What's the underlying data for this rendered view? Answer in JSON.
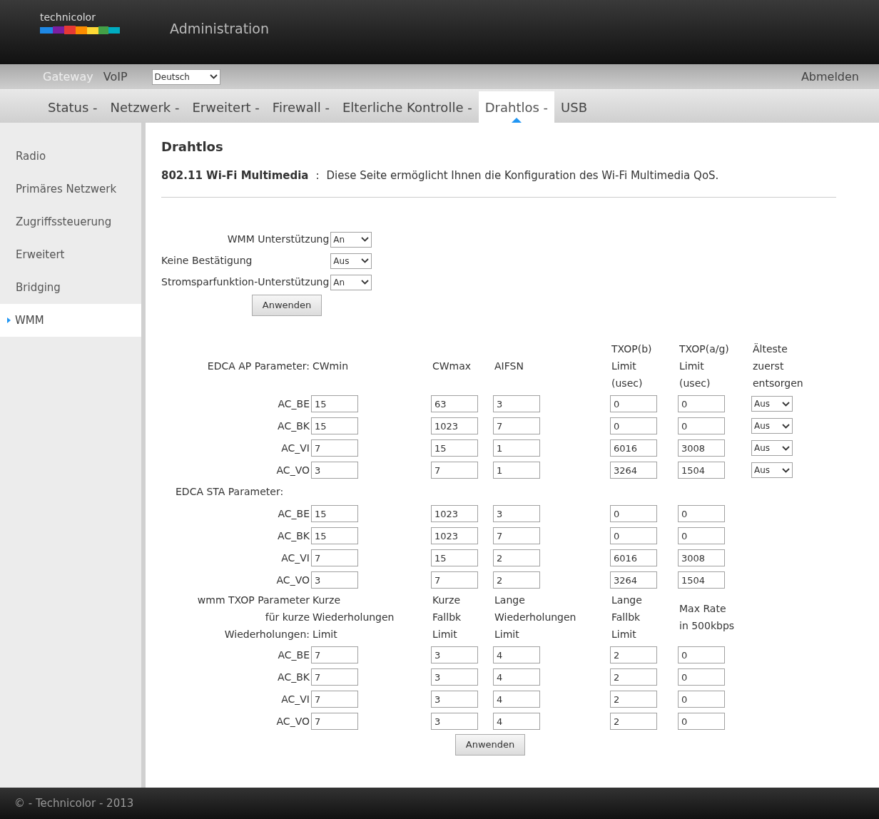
{
  "header": {
    "logo": "technicolor",
    "title": "Administration"
  },
  "top_nav": {
    "items": [
      {
        "label": "Gateway",
        "selected": true
      },
      {
        "label": "VoIP",
        "selected": false
      }
    ],
    "language": "Deutsch",
    "logout": "Abmelden"
  },
  "main_nav": [
    {
      "label": "Status -",
      "selected": false
    },
    {
      "label": "Netzwerk -",
      "selected": false
    },
    {
      "label": "Erweitert -",
      "selected": false
    },
    {
      "label": "Firewall -",
      "selected": false
    },
    {
      "label": "Elterliche Kontrolle -",
      "selected": false
    },
    {
      "label": "Drahtlos -",
      "selected": true
    },
    {
      "label": "USB",
      "selected": false
    }
  ],
  "sidebar": [
    {
      "label": "Radio",
      "selected": false
    },
    {
      "label": "Primäres Netzwerk",
      "selected": false
    },
    {
      "label": "Zugriffssteuerung",
      "selected": false
    },
    {
      "label": "Erweitert",
      "selected": false
    },
    {
      "label": "Bridging",
      "selected": false
    },
    {
      "label": "WMM",
      "selected": true
    }
  ],
  "page_title": "Drahtlos",
  "intro": {
    "title": "802.11 Wi-Fi Multimedia",
    "separator": ":",
    "text": "Diese Seite ermöglicht Ihnen die Konfiguration des Wi-Fi Multimedia QoS."
  },
  "settings": [
    {
      "label": "WMM Unterstützung",
      "value": "An"
    },
    {
      "label": "Keine Bestätigung",
      "value": "Aus"
    },
    {
      "label": "Stromsparfunktion-Unterstützung",
      "value": "An"
    }
  ],
  "apply_button": "Anwenden",
  "sections": [
    {
      "headers": [
        [
          "EDCA AP Parameter:"
        ],
        [
          "CWmin"
        ],
        [
          "CWmax"
        ],
        [
          "AIFSN"
        ],
        [
          "TXOP(b)",
          "Limit",
          "(usec)"
        ],
        [
          "TXOP(a/g)",
          "Limit",
          "(usec)"
        ],
        [
          "Älteste",
          "zuerst",
          "entsorgen"
        ]
      ],
      "rows": [
        {
          "label": "AC_BE",
          "values": [
            "15",
            "63",
            "3",
            "0",
            "0"
          ],
          "select": "Aus"
        },
        {
          "label": "AC_BK",
          "values": [
            "15",
            "1023",
            "7",
            "0",
            "0"
          ],
          "select": "Aus"
        },
        {
          "label": "AC_VI",
          "values": [
            "7",
            "15",
            "1",
            "6016",
            "3008"
          ],
          "select": "Aus"
        },
        {
          "label": "AC_VO",
          "values": [
            "3",
            "7",
            "1",
            "3264",
            "1504"
          ],
          "select": "Aus"
        }
      ]
    },
    {
      "headers": [
        [
          "EDCA STA Parameter:"
        ]
      ],
      "rows": [
        {
          "label": "AC_BE",
          "values": [
            "15",
            "1023",
            "3",
            "0",
            "0"
          ]
        },
        {
          "label": "AC_BK",
          "values": [
            "15",
            "1023",
            "7",
            "0",
            "0"
          ]
        },
        {
          "label": "AC_VI",
          "values": [
            "7",
            "15",
            "2",
            "6016",
            "3008"
          ]
        },
        {
          "label": "AC_VO",
          "values": [
            "3",
            "7",
            "2",
            "3264",
            "1504"
          ]
        }
      ]
    },
    {
      "headers": [
        [
          "wmm TXOP Parameter",
          "für kurze",
          "Wiederholungen:"
        ],
        [
          "Kurze",
          "Wiederholungen",
          "Limit"
        ],
        [
          "Kurze",
          "Fallbk",
          "Limit"
        ],
        [
          "Lange",
          "Wiederholungen",
          "Limit"
        ],
        [
          "Lange",
          "Fallbk",
          "Limit"
        ],
        [
          "Max Rate",
          "in 500kbps"
        ]
      ],
      "rows": [
        {
          "label": "AC_BE",
          "values": [
            "7",
            "3",
            "4",
            "2",
            "0"
          ]
        },
        {
          "label": "AC_BK",
          "values": [
            "7",
            "3",
            "4",
            "2",
            "0"
          ]
        },
        {
          "label": "AC_VI",
          "values": [
            "7",
            "3",
            "4",
            "2",
            "0"
          ]
        },
        {
          "label": "AC_VO",
          "values": [
            "7",
            "3",
            "4",
            "2",
            "0"
          ]
        }
      ]
    }
  ],
  "apply_button_2": "Anwenden",
  "footer": "© - Technicolor - 2013"
}
